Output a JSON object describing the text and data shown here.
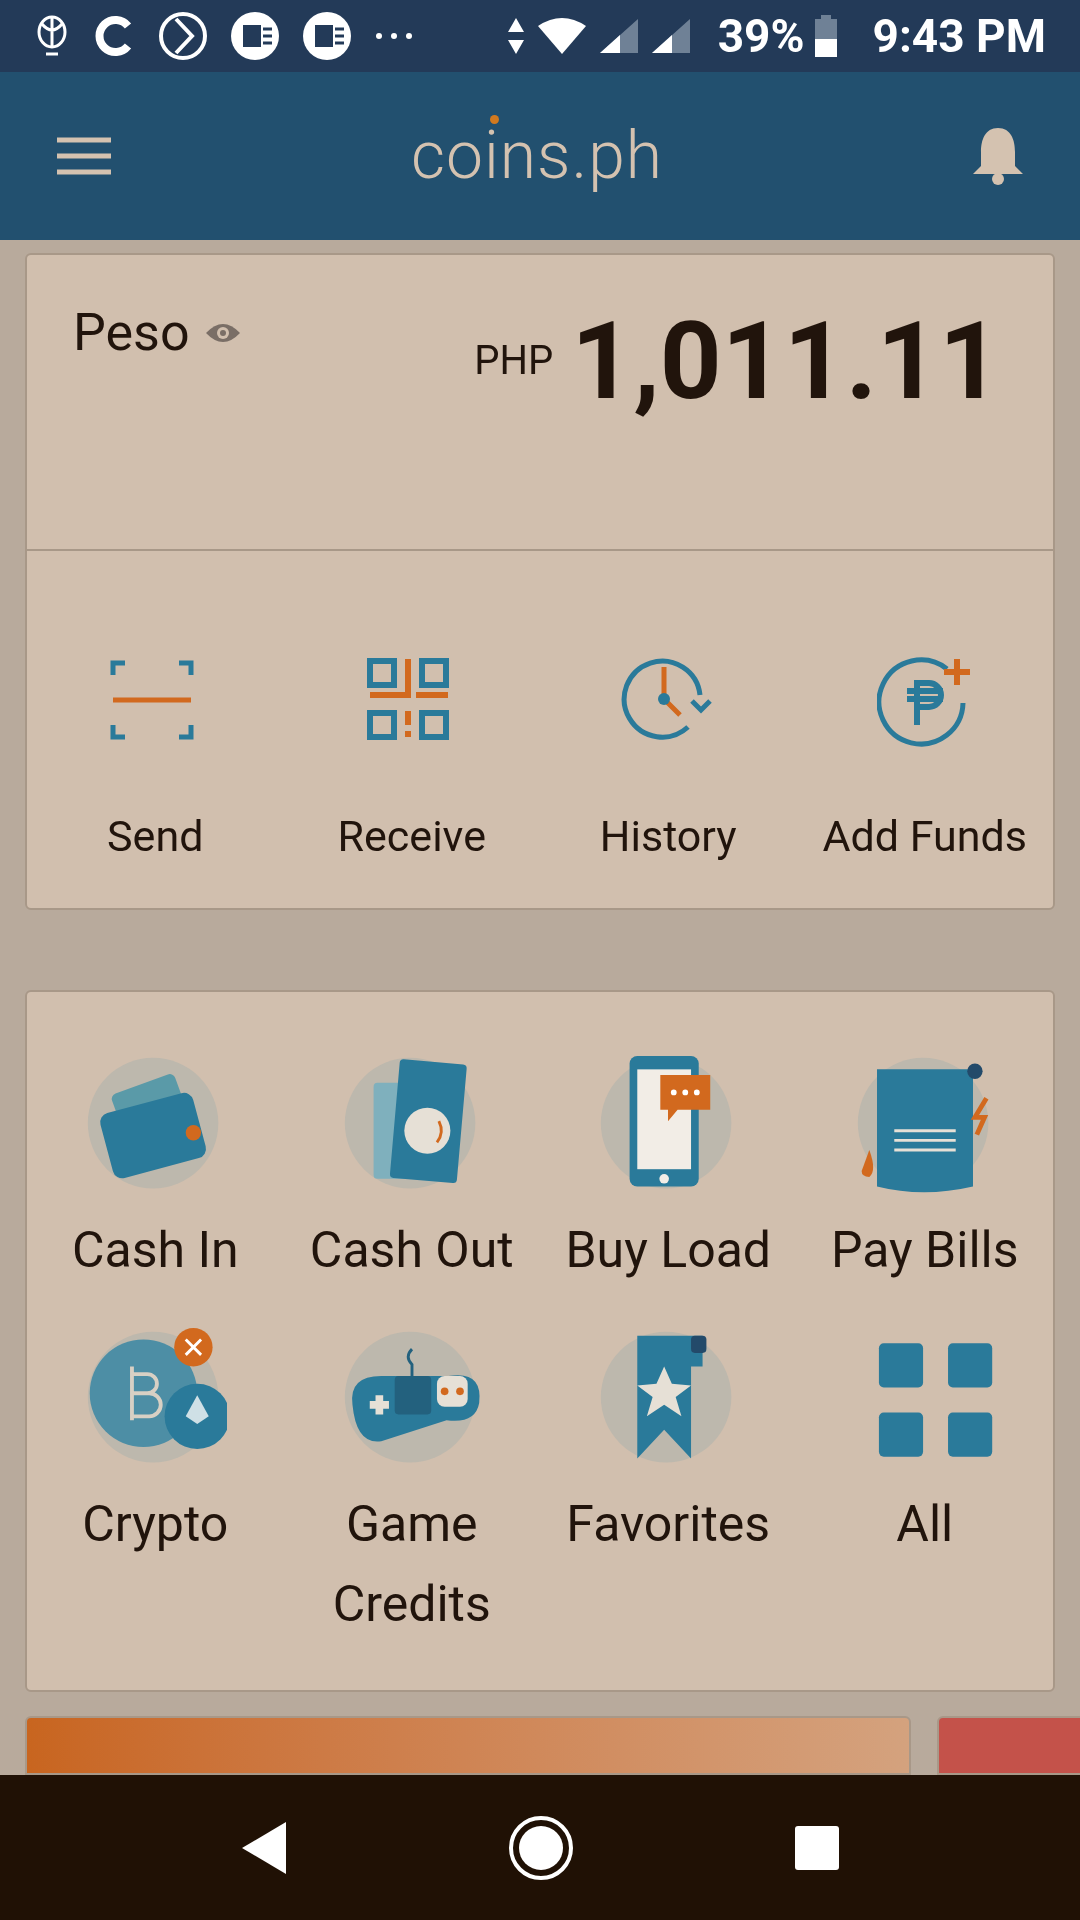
{
  "status_bar": {
    "battery": "39%",
    "time": "9:43 PM"
  },
  "app_bar": {
    "logo": "coins.ph"
  },
  "balance": {
    "currency_name": "Peso",
    "currency_code": "PHP",
    "amount": "1,011.11"
  },
  "actions": [
    {
      "label": "Send"
    },
    {
      "label": "Receive"
    },
    {
      "label": "History"
    },
    {
      "label": "Add Funds"
    }
  ],
  "services": [
    {
      "label": "Cash In"
    },
    {
      "label": "Cash Out"
    },
    {
      "label": "Buy Load"
    },
    {
      "label": "Pay Bills"
    },
    {
      "label": "Crypto"
    },
    {
      "label": "Game Credits"
    },
    {
      "label": "Favorites"
    },
    {
      "label": "All"
    }
  ]
}
